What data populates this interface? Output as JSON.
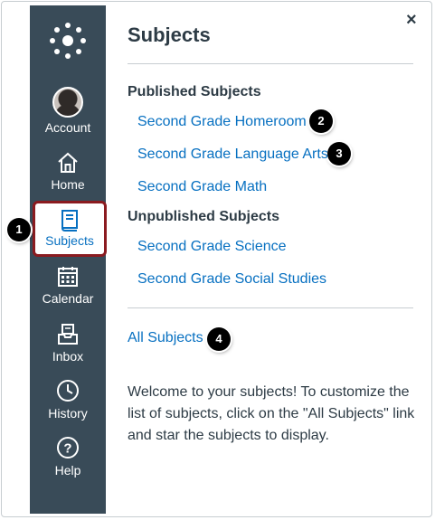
{
  "nav": {
    "account": "Account",
    "home": "Home",
    "subjects": "Subjects",
    "calendar": "Calendar",
    "inbox": "Inbox",
    "history": "History",
    "help": "Help"
  },
  "tray": {
    "title": "Subjects",
    "close": "×",
    "published_heading": "Published Subjects",
    "published": [
      "Second Grade Homeroom",
      "Second Grade Language Arts",
      "Second Grade Math"
    ],
    "unpublished_heading": "Unpublished Subjects",
    "unpublished": [
      "Second Grade Science",
      "Second Grade Social Studies"
    ],
    "all_subjects": "All Subjects",
    "welcome": "Welcome to your subjects! To customize the list of subjects, click on the \"All Subjects\" link and star the subjects to display."
  },
  "badges": [
    "1",
    "2",
    "3",
    "4"
  ],
  "colors": {
    "sidebar": "#394b58",
    "link": "#0770c1",
    "active_border": "#8b1b20",
    "text": "#2d3b45"
  }
}
